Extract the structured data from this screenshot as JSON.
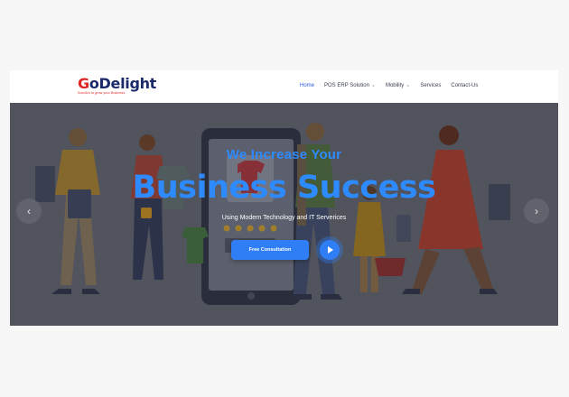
{
  "brand": {
    "name_prefix": "G",
    "name_rest": "oDelight",
    "tagline": "Solution to grow your Business"
  },
  "nav": {
    "items": [
      {
        "label": "Home",
        "active": true,
        "dropdown": false
      },
      {
        "label": "POS ERP Solution",
        "active": false,
        "dropdown": true
      },
      {
        "label": "Mobility",
        "active": false,
        "dropdown": true
      },
      {
        "label": "Services",
        "active": false,
        "dropdown": false
      },
      {
        "label": "Contact-Us",
        "active": false,
        "dropdown": false
      }
    ]
  },
  "hero": {
    "subheading": "We Increase Your",
    "headline": "Business Success",
    "tagline": "Using Modern Technology and IT Serverices",
    "cta_label": "Free Consultation"
  },
  "colors": {
    "accent": "#2e8bff",
    "button": "#2f7ef5",
    "nav_active": "#2a5bd7",
    "brand_red": "#e02424",
    "brand_navy": "#1c2a6b"
  },
  "icons": {
    "prev": "chevron-left-icon",
    "next": "chevron-right-icon",
    "play": "play-icon",
    "dropdown": "chevron-down-icon"
  }
}
